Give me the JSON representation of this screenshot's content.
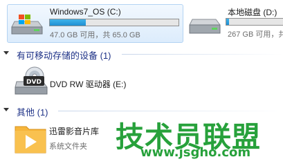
{
  "drives": [
    {
      "name": "Windows7_OS (C:)",
      "space_text": "47.0 GB 可用，共 65.0 GB",
      "used_fraction": 0.28,
      "icon": "hard-drive-windows-icon"
    },
    {
      "name": "本地磁盘 (D:)",
      "space_text": "267 GB 可用，共 2",
      "used_fraction": 0.05,
      "icon": "hard-drive-icon"
    }
  ],
  "removable_group": {
    "header": "有可移动存储的设备 (1)",
    "items": [
      {
        "label": "DVD RW 驱动器 (E:)",
        "icon": "dvd-drive-icon"
      }
    ]
  },
  "other_group": {
    "header": "其他 (1)",
    "items": [
      {
        "label": "迅雷影音片库",
        "sublabel": "系统文件夹",
        "icon": "media-library-folder-icon"
      }
    ]
  },
  "watermark": {
    "text": "技术员联盟",
    "url": "www.jsgho.com",
    "color": "#27a13b"
  }
}
